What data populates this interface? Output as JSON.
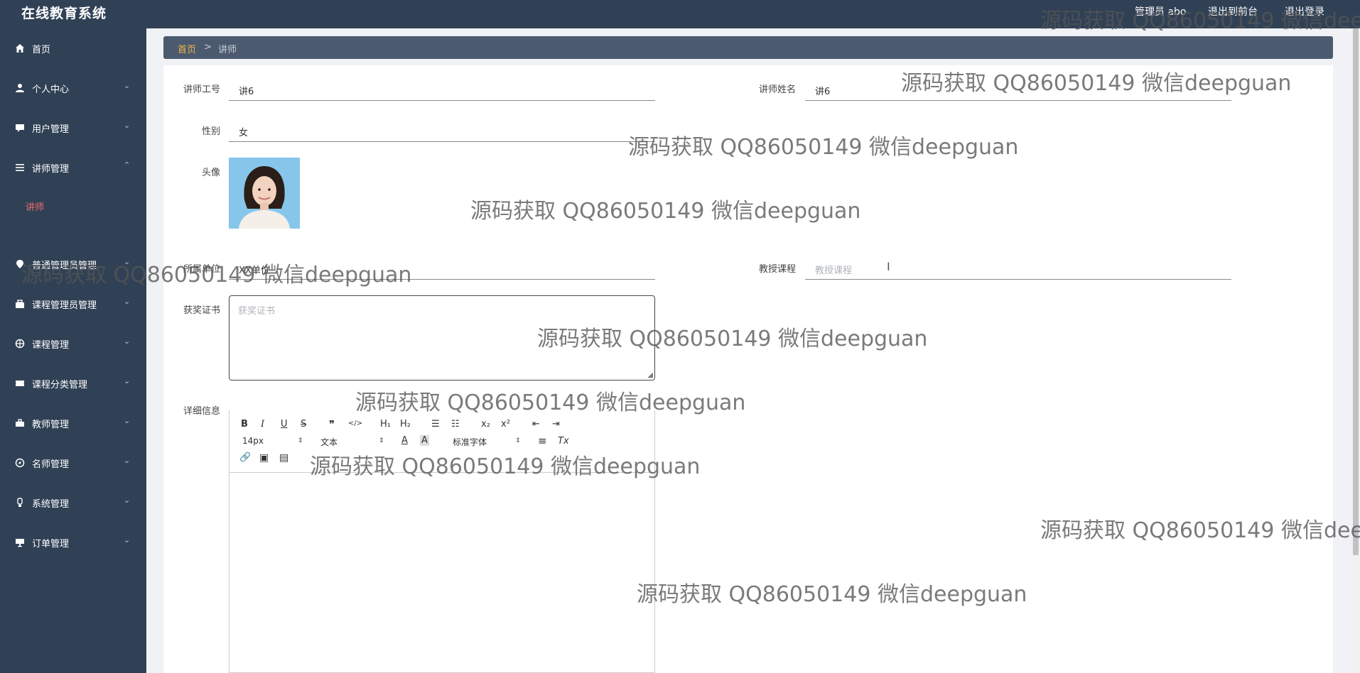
{
  "app": {
    "title": "在线教育系统"
  },
  "header": {
    "links": [
      {
        "label": "管理员 abo"
      },
      {
        "label": "退出到前台"
      },
      {
        "label": "退出登录"
      }
    ]
  },
  "sidebar": {
    "items": [
      {
        "label": "首页",
        "icon": "home-icon"
      },
      {
        "label": "个人中心",
        "icon": "user-icon"
      },
      {
        "label": "用户管理",
        "icon": "chat-icon"
      },
      {
        "label": "讲师管理",
        "icon": "menu-icon"
      },
      {
        "label": "普通管理员管理",
        "icon": "pin-icon"
      },
      {
        "label": "课程管理员管理",
        "icon": "case-icon"
      },
      {
        "label": "课程管理",
        "icon": "globe-icon"
      },
      {
        "label": "课程分类管理",
        "icon": "ticket-icon"
      },
      {
        "label": "教师管理",
        "icon": "briefcase-icon"
      },
      {
        "label": "名师管理",
        "icon": "compass-icon"
      },
      {
        "label": "系统管理",
        "icon": "bulb-icon"
      },
      {
        "label": "订单管理",
        "icon": "monitor-icon"
      }
    ],
    "active_sub": "讲师",
    "chevron_up": "⌃",
    "chevron_down": "⌄"
  },
  "breadcrumb": {
    "home": "首页",
    "separator": ">",
    "current": "讲师"
  },
  "form": {
    "teacher_id": {
      "label": "讲师工号",
      "value": "讲6"
    },
    "teacher_name": {
      "label": "讲师姓名",
      "value": "讲6"
    },
    "gender": {
      "label": "性别",
      "value": "女"
    },
    "avatar": {
      "label": "头像"
    },
    "unit": {
      "label": "所属单位",
      "value": "XX单位"
    },
    "course": {
      "label": "教授课程",
      "placeholder": "教授课程"
    },
    "awards": {
      "label": "获奖证书",
      "placeholder": "获奖证书"
    },
    "details": {
      "label": "详细信息"
    }
  },
  "editor": {
    "toolbar_row1": [
      "B",
      "I",
      "U",
      "S",
      "❞",
      "</>",
      "H₁",
      "H₂",
      "☰",
      "☷",
      "x₂",
      "x²",
      "⇤",
      "⇥"
    ],
    "font_size": "14px",
    "text_type": "文本",
    "font_family": "标准字体",
    "text_color_glyph": "A",
    "bg_color_glyph": "A",
    "align_glyph": "≡",
    "clear_glyph": "Tx",
    "row3": [
      "🔗",
      "▣",
      "▤"
    ],
    "select_arrow": "⇕"
  },
  "watermark": {
    "text": "源码获取 QQ86050149 微信deepguan"
  }
}
